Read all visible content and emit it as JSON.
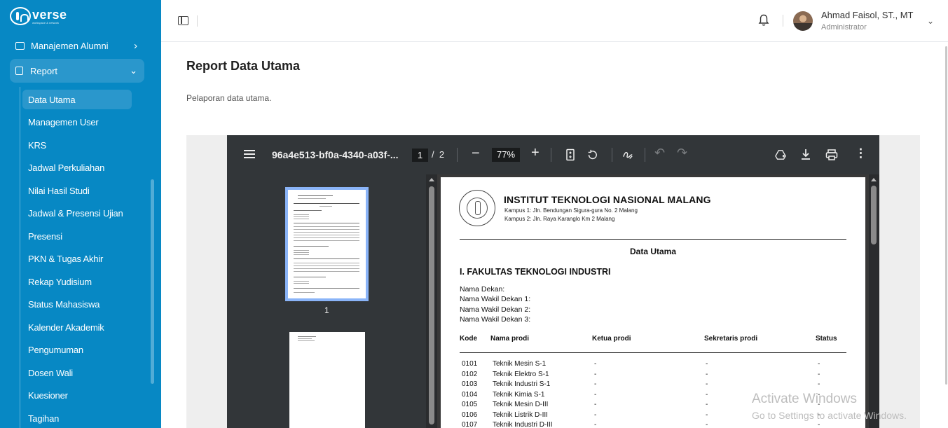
{
  "sidebar": {
    "logo_text": "verse",
    "logo_tagline": "workspace & network",
    "nav_alumni": "Manajemen Alumni",
    "nav_report": "Report",
    "sub_items": [
      {
        "label": "Data Utama"
      },
      {
        "label": "Managemen User"
      },
      {
        "label": "KRS"
      },
      {
        "label": "Jadwal Perkuliahan"
      },
      {
        "label": "Nilai Hasil Studi"
      },
      {
        "label": "Jadwal & Presensi Ujian"
      },
      {
        "label": "Presensi"
      },
      {
        "label": "PKN & Tugas Akhir"
      },
      {
        "label": "Rekap Yudisium"
      },
      {
        "label": "Status Mahasiswa"
      },
      {
        "label": "Kalender Akademik"
      },
      {
        "label": "Pengumuman"
      },
      {
        "label": "Dosen Wali"
      },
      {
        "label": "Kuesioner"
      },
      {
        "label": "Tagihan"
      }
    ],
    "active_item": "Data Utama"
  },
  "header": {
    "user_name": "Ahmad Faisol, ST., MT",
    "user_role": "Administrator"
  },
  "main": {
    "title": "Report Data Utama",
    "subtitle": "Pelaporan data utama."
  },
  "pdf_viewer": {
    "doc_name": "96a4e513-bf0a-4340-a03f-...",
    "current_page": "1",
    "page_sep": "/",
    "total_pages": "2",
    "zoom": "77%",
    "thumb_label": "1"
  },
  "document": {
    "institution": "INSTITUT TEKNOLOGI NASIONAL MALANG",
    "campus1": "Kampus 1: Jln. Bendungan Sigura-gura No. 2 Malang",
    "campus2": "Kampus 2: Jln. Raya Karanglo Km 2 Malang",
    "title": "Data Utama",
    "faculty": "I. FAKULTAS TEKNOLOGI INDUSTRI",
    "dekan_lines": [
      "Nama Dekan:",
      "Nama Wakil Dekan 1:",
      "Nama Wakil Dekan 2:",
      "Nama Wakil Dekan 3:"
    ],
    "table_headers": [
      "Kode",
      "Nama prodi",
      "Ketua prodi",
      "Sekretaris prodi",
      "Status"
    ],
    "rows": [
      {
        "kode": "0101",
        "nama": "Teknik Mesin S-1",
        "ketua": "-",
        "sekretaris": "-",
        "status": "-"
      },
      {
        "kode": "0102",
        "nama": "Teknik Elektro S-1",
        "ketua": "-",
        "sekretaris": "-",
        "status": "-"
      },
      {
        "kode": "0103",
        "nama": "Teknik Industri S-1",
        "ketua": "-",
        "sekretaris": "-",
        "status": "-"
      },
      {
        "kode": "0104",
        "nama": "Teknik Kimia S-1",
        "ketua": "-",
        "sekretaris": "-",
        "status": "-"
      },
      {
        "kode": "0105",
        "nama": "Teknik Mesin D-III",
        "ketua": "-",
        "sekretaris": "-",
        "status": "-"
      },
      {
        "kode": "0106",
        "nama": "Teknik Listrik D-III",
        "ketua": "-",
        "sekretaris": "-",
        "status": "-"
      },
      {
        "kode": "0107",
        "nama": "Teknik Industri D-III",
        "ketua": "-",
        "sekretaris": "-",
        "status": "-"
      }
    ]
  },
  "watermark": {
    "line1": "Activate Windows",
    "line2": "Go to Settings to activate Windows."
  },
  "colors": {
    "sidebar_bg": "#0788c4",
    "sidebar_active": "#2a97cc",
    "viewer_toolbar": "#323639",
    "thumb_border": "#8ab4f8"
  }
}
